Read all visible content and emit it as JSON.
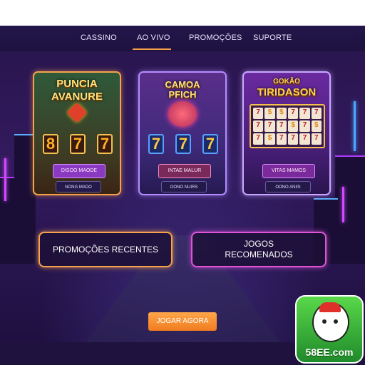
{
  "nav": {
    "items": [
      {
        "label": "CASSINO"
      },
      {
        "label": "AO VIVO"
      },
      {
        "label": "PROMOÇÕES"
      },
      {
        "label": "SUPORTE"
      }
    ],
    "active": "AO VIVO"
  },
  "cards": [
    {
      "title_line1": "PUNCIA",
      "title_line2": "AVANURE",
      "reels": [
        "8",
        "7",
        "7"
      ],
      "primary_button": "DISOO MAODE",
      "secondary_button": "NONG MADO"
    },
    {
      "title_line1": "CAMOA",
      "title_line2": "PFICH",
      "reels": [
        "7",
        "7",
        "7"
      ],
      "primary_button": "INTAE MALUR",
      "secondary_button": "OONO NUIRS"
    },
    {
      "title_line1": "GOKÃO",
      "title_line2": "TIRIDASON",
      "grid_symbols": [
        "7",
        "$",
        "$",
        "7",
        "7",
        "7",
        "7",
        "7",
        "7",
        "$",
        "7",
        "$",
        "7",
        "$",
        "7",
        "7",
        "7",
        "7"
      ],
      "primary_button": "VITAS MAMOS",
      "secondary_button": "OONO ANIIS"
    }
  ],
  "promo_left": {
    "label": "PROMOÇÕES RECENTES"
  },
  "promo_right": {
    "label_line1": "JOGOS",
    "label_line2": "RECOMENADOS"
  },
  "cta": {
    "label": "JOGAR AGORA"
  },
  "brand": {
    "logo_text": "58EE.com"
  },
  "colors": {
    "accent": "#f5a24a",
    "neon_pink": "#e054d8",
    "background": "#160c2a"
  }
}
